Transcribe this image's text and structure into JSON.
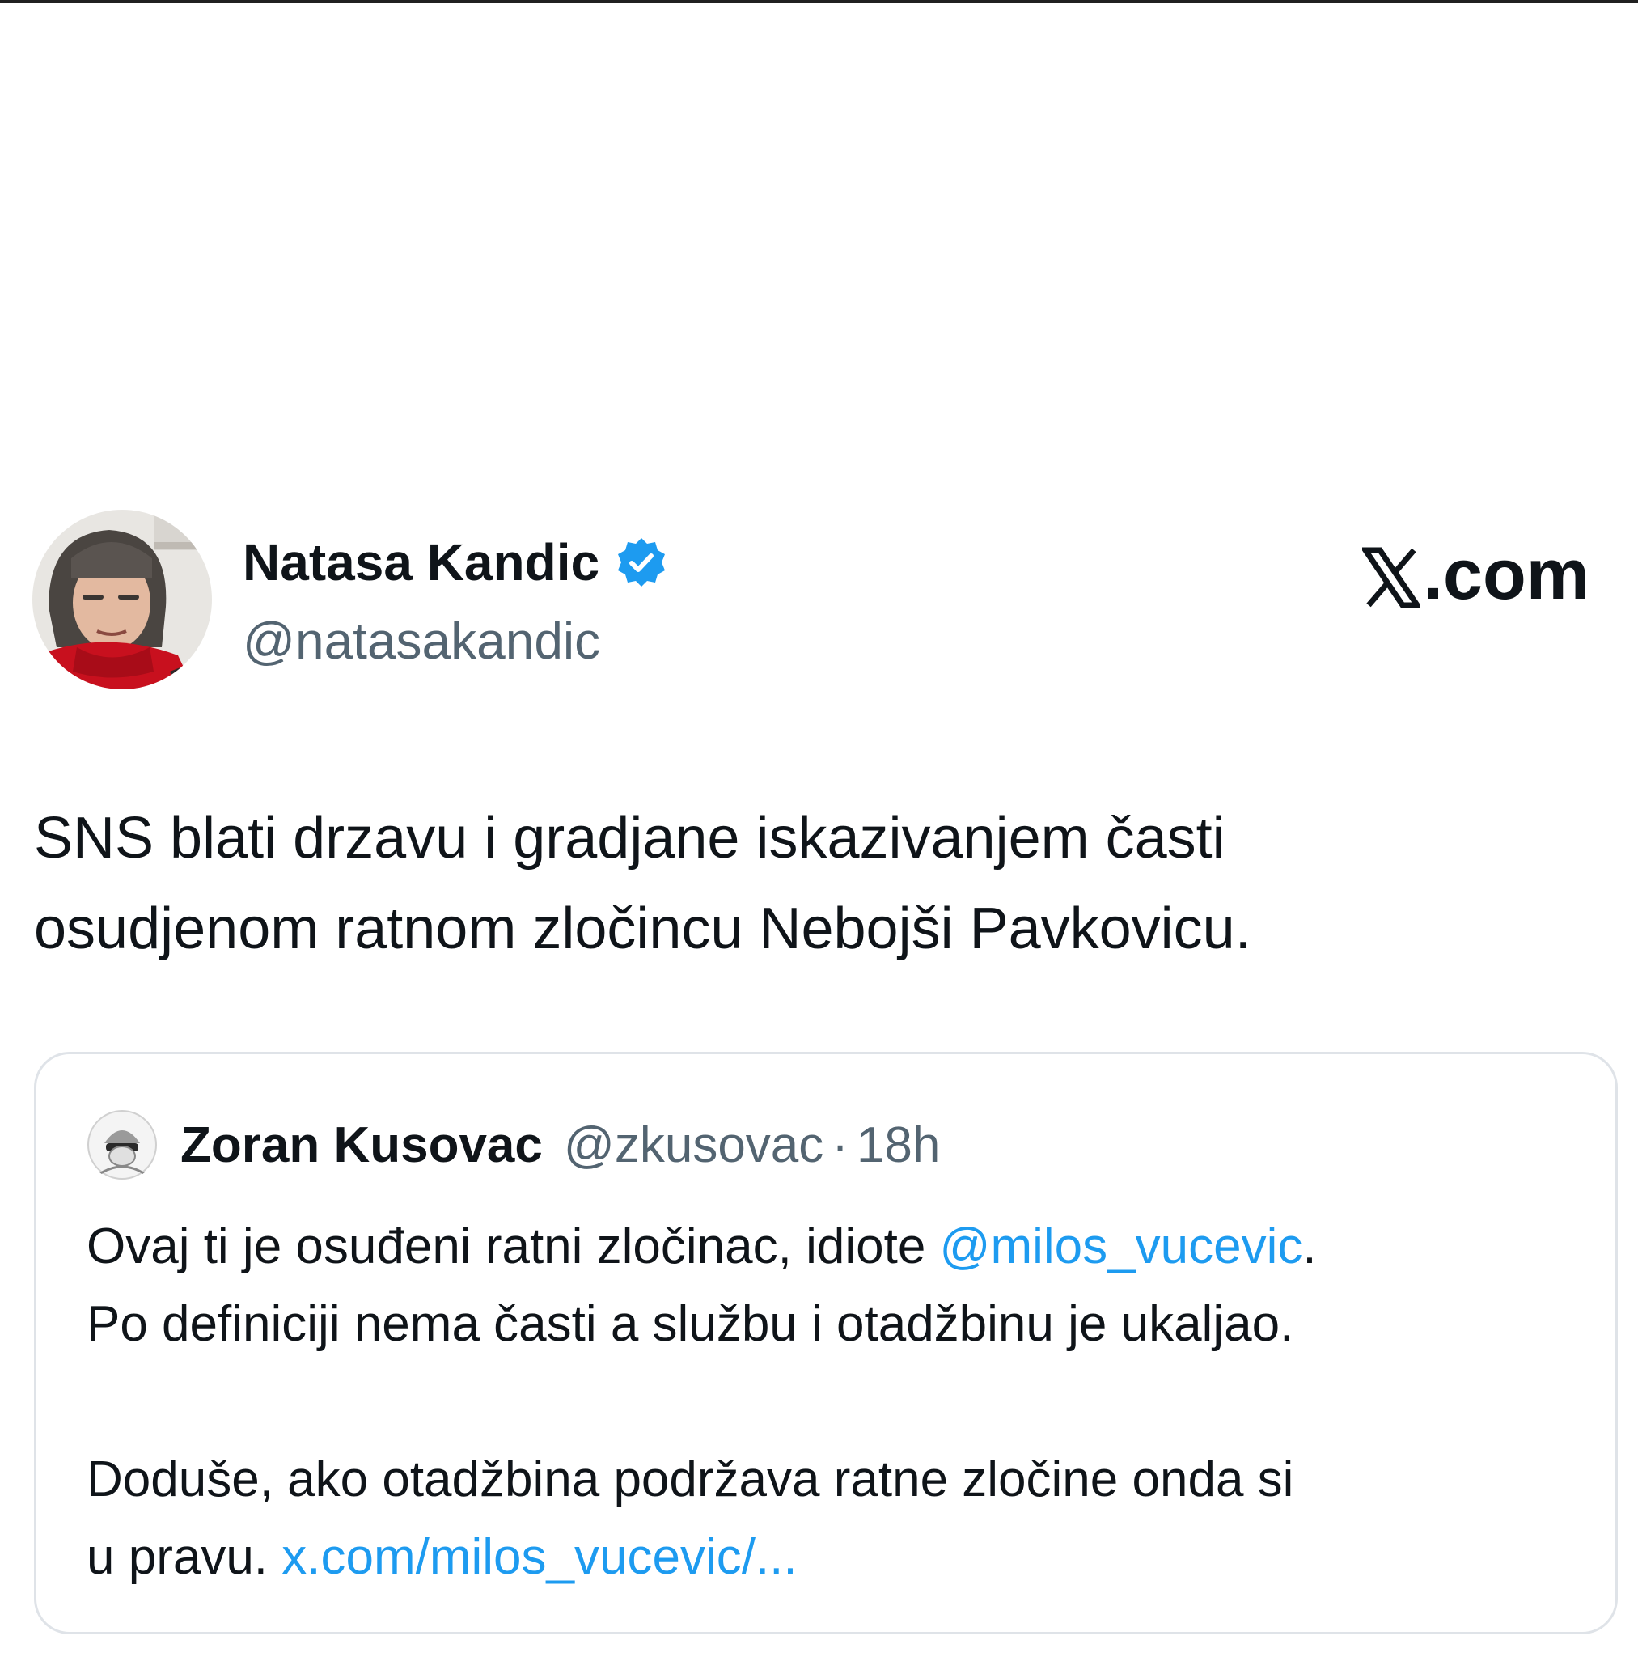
{
  "brand": {
    "domain_suffix": ".com",
    "logo_icon": "x-logo-icon"
  },
  "author": {
    "display_name": "Natasa Kandic",
    "handle": "@natasakandic",
    "verified": true,
    "verified_color": "#1d9bf0"
  },
  "tweet": {
    "lines": [
      "SNS blati drzavu i gradjane iskazivanjem  časti",
      "osudjenom ratnom zločincu Nebojši Pavkovicu."
    ]
  },
  "quoted": {
    "display_name": "Zoran Kusovac",
    "handle": "@zkusovac",
    "separator": "·",
    "time": "18h",
    "line1_prefix": "Ovaj ti je osuđeni ratni zločinac, idiote ",
    "line1_mention": "@milos_vucevic",
    "line1_suffix": ".",
    "line2": "Po definiciji nema časti a službu i otadžbinu je ukaljao.",
    "line3": "Doduše, ako otadžbina podržava ratne zločine onda si",
    "line4_prefix": "u pravu. ",
    "line4_link": "x.com/milos_vucevic/..."
  },
  "colors": {
    "link": "#1d9bf0",
    "secondary_text": "#536471",
    "primary_text": "#0f1419"
  }
}
